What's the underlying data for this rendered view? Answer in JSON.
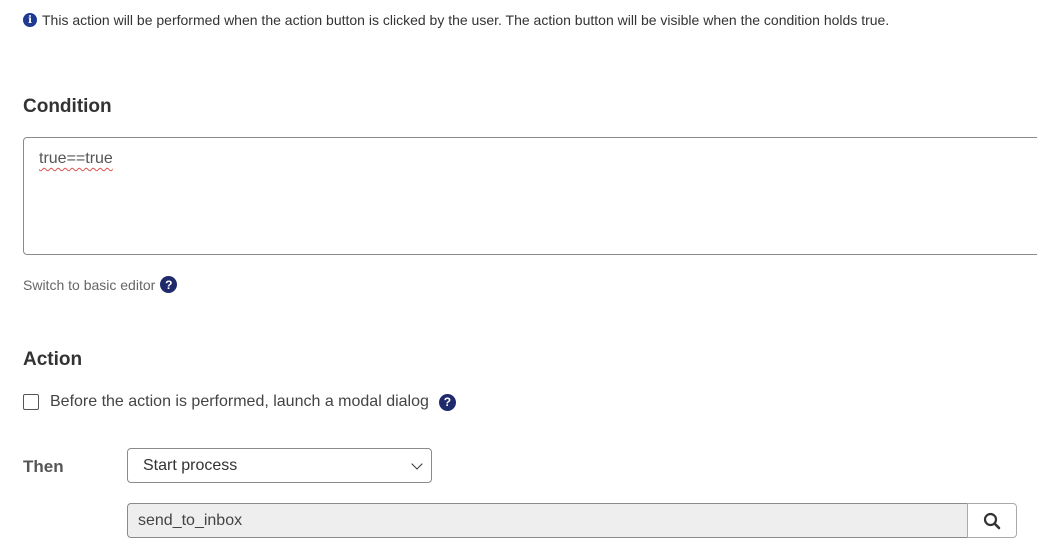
{
  "info": {
    "icon": "info-icon",
    "icon_glyph": "i",
    "text": "This action will be performed when the action button is clicked by the user. The action button will be visible when the condition holds true."
  },
  "condition": {
    "title": "Condition",
    "value": "true==true",
    "switch_label": "Switch to basic editor",
    "help_glyph": "?"
  },
  "action": {
    "title": "Action",
    "modal_checkbox_label": "Before the action is performed, launch a modal dialog",
    "modal_checked": false,
    "help_glyph": "?",
    "then_label": "Then",
    "then_selected": "Start process",
    "process_value": "send_to_inbox"
  },
  "colors": {
    "accent": "#1e2a6b",
    "text": "#333333",
    "error_underline": "#d9534f",
    "readonly_bg": "#eeeeee"
  }
}
